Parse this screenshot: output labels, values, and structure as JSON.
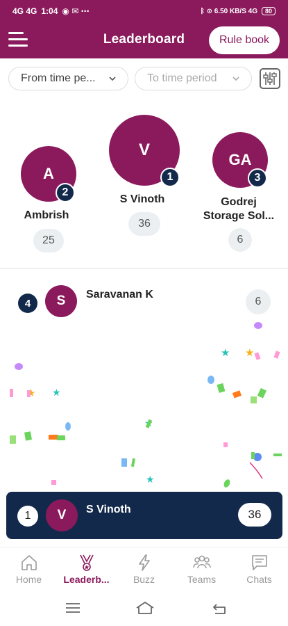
{
  "status_bar": {
    "time": "1:04",
    "left_icons": "4G 4G",
    "right_icons": "ᛒ ⊙ 6.50 KB/S 4G",
    "battery": "80"
  },
  "header": {
    "title": "Leaderboard",
    "rule_book_label": "Rule book"
  },
  "filters": {
    "from_label": "From time pe...",
    "to_label": "To time period"
  },
  "podium": {
    "first": {
      "initial": "V",
      "rank": "1",
      "name": "S Vinoth",
      "score": "36"
    },
    "second": {
      "initial": "A",
      "rank": "2",
      "name": "Ambrish",
      "score": "25"
    },
    "third": {
      "initial": "GA",
      "rank": "3",
      "name_line1": "Godrej",
      "name_line2": "Storage Sol...",
      "score": "6"
    }
  },
  "list": [
    {
      "rank": "4",
      "initial": "S",
      "name": "Saravanan K",
      "score": "6"
    }
  ],
  "my_rank": {
    "rank": "1",
    "initial": "V",
    "name": "S Vinoth",
    "score": "36"
  },
  "bottom_nav": [
    {
      "label": "Home",
      "icon": "home-icon"
    },
    {
      "label": "Leaderb...",
      "icon": "trophy-icon",
      "active": true
    },
    {
      "label": "Buzz",
      "icon": "lightning-icon"
    },
    {
      "label": "Teams",
      "icon": "teams-icon"
    },
    {
      "label": "Chats",
      "icon": "chat-icon"
    }
  ],
  "colors": {
    "brand": "#8b1a5c",
    "navy": "#13294b",
    "pill_bg": "#eceff1"
  }
}
